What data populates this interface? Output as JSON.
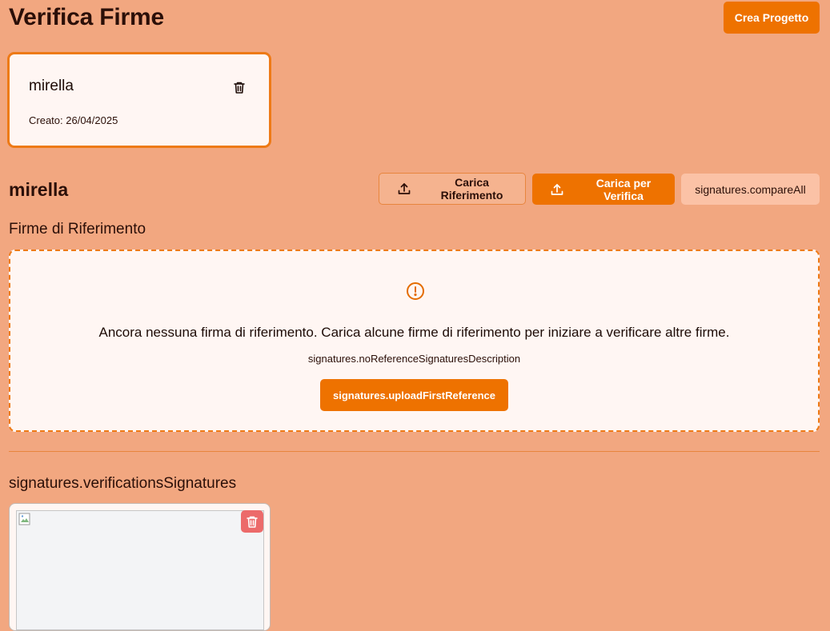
{
  "header": {
    "title": "Verifica Firme",
    "create_project_label": "Crea Progetto"
  },
  "project_card": {
    "name": "mirella",
    "created": "Creato: 26/04/2025",
    "delete_icon": "trash-icon"
  },
  "project_section": {
    "title": "mirella",
    "upload_reference_label": "Carica Riferimento",
    "upload_reference_icon": "upload-icon",
    "upload_verification_label": "Carica per Verifica",
    "upload_verification_icon": "upload-icon",
    "compare_all_label": "signatures.compareAll"
  },
  "reference_signatures": {
    "title": "Firme di Riferimento",
    "empty_icon": "alert-circle-icon",
    "empty_title": "Ancora nessuna firma di riferimento. Carica alcune firme di riferimento per iniziare a verificare altre firme.",
    "empty_description": "signatures.noReferenceSignaturesDescription",
    "upload_first_label": "signatures.uploadFirstReference"
  },
  "verification_signatures": {
    "title": "signatures.verificationsSignatures",
    "items": [
      {
        "image": "broken-image-icon",
        "delete_icon": "trash-icon"
      }
    ]
  },
  "colors": {
    "background": "#f2a780",
    "accent": "#ee7200",
    "card": "#fff6f3",
    "danger": "#ec6a6a"
  }
}
